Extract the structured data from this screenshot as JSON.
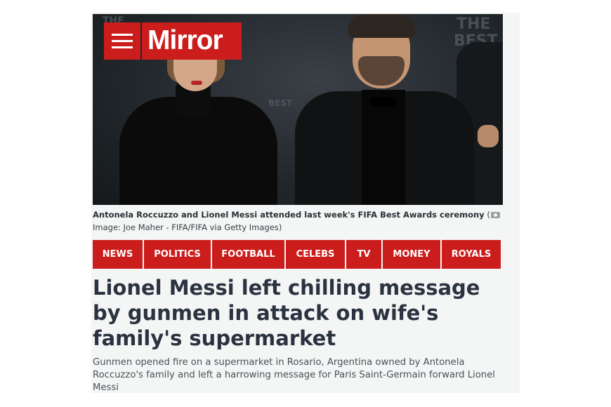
{
  "header": {
    "brand": "Mirror",
    "menu_icon": "hamburger-menu-icon",
    "brand_color": "#cc1d1d"
  },
  "hero": {
    "backdrop_text": [
      "THE",
      "BEST",
      "THE",
      "BEST"
    ],
    "caption_main": "Antonela Roccuzzo and Lionel Messi attended last week's FIFA Best Awards ceremony",
    "camera_icon": "camera-icon",
    "caption_credit": "Image: Joe Maher - FIFA/FIFA via Getty Images"
  },
  "nav": {
    "items": [
      {
        "label": "NEWS"
      },
      {
        "label": "POLITICS"
      },
      {
        "label": "FOOTBALL"
      },
      {
        "label": "CELEBS"
      },
      {
        "label": "TV"
      },
      {
        "label": "MONEY"
      },
      {
        "label": "ROYALS"
      }
    ]
  },
  "article": {
    "headline": "Lionel Messi left chilling message by gunmen in attack on wife's family's supermarket",
    "standfirst": "Gunmen opened fire on a supermarket in Rosario, Argentina owned by Antonela Roccuzzo's family and left a harrowing message for Paris Saint-Germain forward Lionel Messi"
  }
}
